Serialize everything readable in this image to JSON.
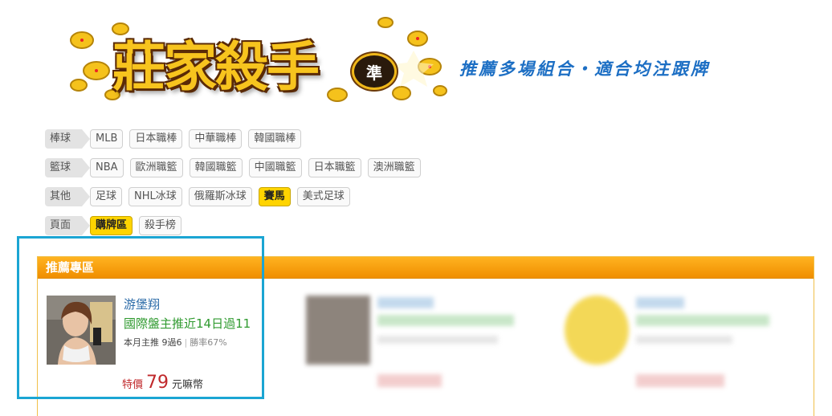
{
  "banner": {
    "logo_text": "莊家殺手",
    "logo_badge": "準",
    "tagline": "推薦多場組合・適合均注跟牌"
  },
  "filters": [
    {
      "label": "棒球",
      "chips": [
        {
          "text": "MLB",
          "active": false
        },
        {
          "text": "日本職棒",
          "active": false
        },
        {
          "text": "中華職棒",
          "active": false
        },
        {
          "text": "韓國職棒",
          "active": false
        }
      ]
    },
    {
      "label": "籃球",
      "chips": [
        {
          "text": "NBA",
          "active": false
        },
        {
          "text": "歐洲職籃",
          "active": false
        },
        {
          "text": "韓國職籃",
          "active": false
        },
        {
          "text": "中國職籃",
          "active": false
        },
        {
          "text": "日本職籃",
          "active": false
        },
        {
          "text": "澳洲職籃",
          "active": false
        }
      ]
    },
    {
      "label": "其他",
      "chips": [
        {
          "text": "足球",
          "active": false
        },
        {
          "text": "NHL冰球",
          "active": false
        },
        {
          "text": "俄羅斯冰球",
          "active": false
        },
        {
          "text": "賽馬",
          "active": true
        },
        {
          "text": "美式足球",
          "active": false
        }
      ]
    },
    {
      "label": "頁面",
      "chips": [
        {
          "text": "購牌區",
          "active": true
        },
        {
          "text": "殺手榜",
          "active": false
        }
      ]
    }
  ],
  "panel": {
    "title": "推薦專區",
    "expert": {
      "name": "游堡翔",
      "desc": "國際盤主推近14日過11",
      "stats_main": "本月主推 9過6",
      "stats_rate": "勝率67%",
      "price_prefix": "特價",
      "price_value": "79",
      "price_unit": "元嘛幣"
    }
  },
  "colors": {
    "accent_orange": "#f5a000",
    "highlight_blue": "#1ba5d3",
    "active_chip": "#ffd400",
    "name_blue": "#2d6ca8",
    "desc_green": "#2f9a2f",
    "price_red": "#c0282b",
    "tagline_blue": "#1d6fc4"
  }
}
